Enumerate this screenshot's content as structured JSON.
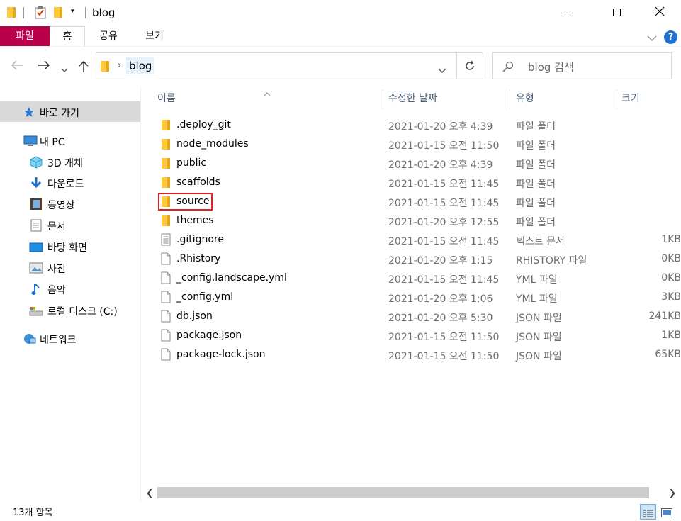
{
  "window": {
    "title": "blog"
  },
  "ribbon": {
    "tabs": [
      {
        "label": "파일",
        "active": true
      },
      {
        "label": "홈"
      },
      {
        "label": "공유"
      },
      {
        "label": "보기"
      }
    ],
    "accent": "#b9004a"
  },
  "address": {
    "path": "blog",
    "search_placeholder": "blog 검색"
  },
  "nav": {
    "items": [
      {
        "label": "바로 가기",
        "icon": "star-icon",
        "selected": true
      },
      {
        "label": "내 PC",
        "icon": "pc-icon"
      },
      {
        "label": "3D 개체",
        "icon": "3d-objects-icon"
      },
      {
        "label": "다운로드",
        "icon": "download-icon"
      },
      {
        "label": "동영상",
        "icon": "video-icon"
      },
      {
        "label": "문서",
        "icon": "document-icon"
      },
      {
        "label": "바탕 화면",
        "icon": "desktop-icon"
      },
      {
        "label": "사진",
        "icon": "pictures-icon"
      },
      {
        "label": "음악",
        "icon": "music-icon"
      },
      {
        "label": "로컬 디스크 (C:)",
        "icon": "local-disk-icon"
      },
      {
        "label": "네트워크",
        "icon": "network-icon"
      }
    ]
  },
  "columns": {
    "name": "이름",
    "date": "수정한 날짜",
    "type": "유형",
    "size": "크기"
  },
  "files": [
    {
      "name": ".deploy_git",
      "date": "2021-01-20 오후 4:39",
      "type": "파일 폴더",
      "size": "",
      "kind": "folder"
    },
    {
      "name": "node_modules",
      "date": "2021-01-15 오전 11:50",
      "type": "파일 폴더",
      "size": "",
      "kind": "folder"
    },
    {
      "name": "public",
      "date": "2021-01-20 오후 4:39",
      "type": "파일 폴더",
      "size": "",
      "kind": "folder"
    },
    {
      "name": "scaffolds",
      "date": "2021-01-15 오전 11:45",
      "type": "파일 폴더",
      "size": "",
      "kind": "folder"
    },
    {
      "name": "source",
      "date": "2021-01-15 오전 11:45",
      "type": "파일 폴더",
      "size": "",
      "kind": "folder",
      "highlighted": true
    },
    {
      "name": "themes",
      "date": "2021-01-20 오후 12:55",
      "type": "파일 폴더",
      "size": "",
      "kind": "folder"
    },
    {
      "name": ".gitignore",
      "date": "2021-01-15 오전 11:45",
      "type": "텍스트 문서",
      "size": "1KB",
      "kind": "text"
    },
    {
      "name": ".Rhistory",
      "date": "2021-01-20 오후 1:15",
      "type": "RHISTORY 파일",
      "size": "0KB",
      "kind": "file"
    },
    {
      "name": "_config.landscape.yml",
      "date": "2021-01-15 오전 11:45",
      "type": "YML 파일",
      "size": "0KB",
      "kind": "file"
    },
    {
      "name": "_config.yml",
      "date": "2021-01-20 오후 1:06",
      "type": "YML 파일",
      "size": "3KB",
      "kind": "file"
    },
    {
      "name": "db.json",
      "date": "2021-01-20 오후 5:30",
      "type": "JSON 파일",
      "size": "241KB",
      "kind": "file"
    },
    {
      "name": "package.json",
      "date": "2021-01-15 오전 11:50",
      "type": "JSON 파일",
      "size": "1KB",
      "kind": "file"
    },
    {
      "name": "package-lock.json",
      "date": "2021-01-15 오전 11:50",
      "type": "JSON 파일",
      "size": "65KB",
      "kind": "file"
    }
  ],
  "status": {
    "count": "13개 항목"
  },
  "colors": {
    "highlight_box": "#e02020",
    "folder": "#ffc83d",
    "selected_nav": "#d9d9d9",
    "help": "#1e6fd0"
  }
}
